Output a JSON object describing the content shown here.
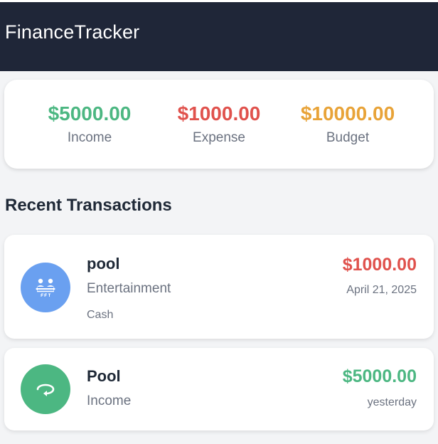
{
  "app": {
    "title": "FinanceTracker"
  },
  "colors": {
    "header_bg": "#1f2638",
    "income": "#4cb782",
    "expense": "#e0524d",
    "budget": "#e8a338",
    "entertainment_icon": "#6aa0f0",
    "income_icon": "#4cb782"
  },
  "summary": {
    "income": {
      "value": "$5000.00",
      "label": "Income"
    },
    "expense": {
      "value": "$1000.00",
      "label": "Expense"
    },
    "budget": {
      "value": "$10000.00",
      "label": "Budget"
    }
  },
  "recent": {
    "title": "Recent Transactions",
    "items": [
      {
        "name": "pool",
        "category": "Entertainment",
        "method": "Cash",
        "amount": "$1000.00",
        "date": "April 21, 2025",
        "icon": "entertainment-icon",
        "type": "expense"
      },
      {
        "name": "Pool",
        "category": "Income",
        "amount": "$5000.00",
        "date": "yesterday",
        "icon": "income-icon",
        "type": "income"
      }
    ]
  }
}
